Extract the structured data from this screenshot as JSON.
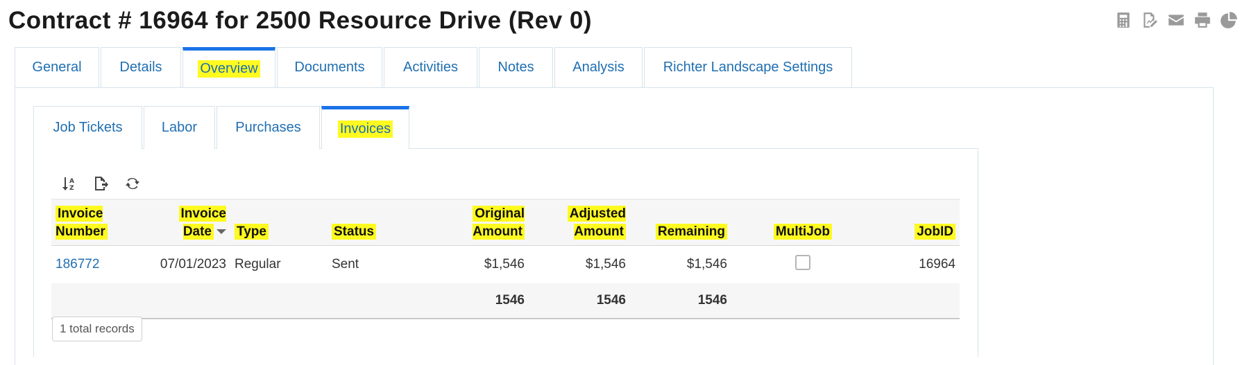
{
  "page": {
    "title": "Contract # 16964 for 2500 Resource Drive (Rev 0)"
  },
  "header_icons": [
    "calculator-icon",
    "edit-document-icon",
    "envelope-icon",
    "printer-icon",
    "pie-chart-icon"
  ],
  "outer_tabs": [
    "General",
    "Details",
    "Overview",
    "Documents",
    "Activities",
    "Notes",
    "Analysis",
    "Richter Landscape Settings"
  ],
  "outer_active": "Overview",
  "inner_tabs": [
    "Job Tickets",
    "Labor",
    "Purchases",
    "Invoices"
  ],
  "inner_active": "Invoices",
  "toolbar": [
    "sort-az-icon",
    "export-icon",
    "refresh-icon"
  ],
  "table": {
    "headers": {
      "invoice_number": [
        "Invoice",
        "Number"
      ],
      "invoice_date": "Invoice Date",
      "type": "Type",
      "status": "Status",
      "original_amount": [
        "Original",
        "Amount"
      ],
      "adjusted_amount": [
        "Adjusted",
        "Amount"
      ],
      "remaining": "Remaining",
      "multijob": "MultiJob",
      "jobid": "JobID"
    },
    "rows": [
      {
        "invoice_number": "186772",
        "invoice_date": "07/01/2023",
        "type": "Regular",
        "status": "Sent",
        "original_amount": "$1,546",
        "adjusted_amount": "$1,546",
        "remaining": "$1,546",
        "multijob": false,
        "jobid": "16964"
      }
    ],
    "totals": {
      "original_amount": "1546",
      "adjusted_amount": "1546",
      "remaining": "1546"
    }
  },
  "footer": {
    "records": "1 total records"
  },
  "colors": {
    "link": "#1f6fb2",
    "active_tab_bar": "#1a73e8",
    "highlight": "#fffa1f"
  }
}
